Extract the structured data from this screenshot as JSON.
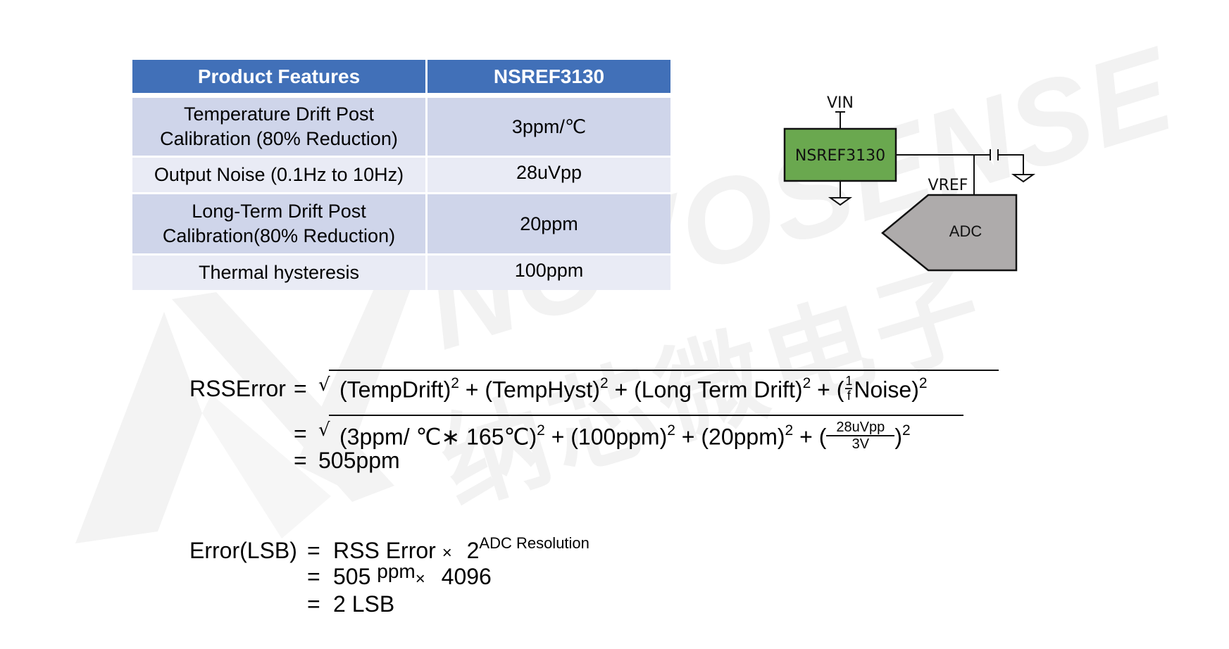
{
  "watermark": {
    "brand_en": "NOVOSENSE",
    "brand_cn": "纳芯微电子"
  },
  "table": {
    "headers": [
      "Product Features",
      "NSREF3130"
    ],
    "rows": [
      {
        "feature_line1": "Temperature Drift Post",
        "feature_line2": "Calibration (80% Reduction)",
        "value": "3ppm/℃"
      },
      {
        "feature_line1": "Output Noise (0.1Hz to 10Hz)",
        "feature_line2": "",
        "value": "28uVpp"
      },
      {
        "feature_line1": "Long-Term Drift Post",
        "feature_line2": "Calibration(80% Reduction)",
        "value": "20ppm"
      },
      {
        "feature_line1": "Thermal hysteresis",
        "feature_line2": "",
        "value": "100ppm"
      }
    ]
  },
  "circuit": {
    "vin_label": "VIN",
    "chip_label": "NSREF3130",
    "vref_label": "VREF",
    "adc_label": "ADC",
    "colors": {
      "chip": "#6aa84f",
      "adc": "#aeabab"
    }
  },
  "rss_formula": {
    "lhs": "RSSError",
    "eq": "=",
    "line1_terms": [
      {
        "text": "(TempDrift)",
        "sup": "2"
      },
      {
        "text": " + (TempHyst)",
        "sup": "2"
      },
      {
        "text": " + (Long Term Drift)",
        "sup": "2"
      },
      {
        "text": " + (",
        "frac_num": "1",
        "frac_den": "f",
        "after": "Noise)",
        "sup": "2"
      }
    ],
    "line2_terms": [
      {
        "text": "(3ppm/ ℃∗ 165℃)",
        "sup": "2"
      },
      {
        "text": " + (100ppm)",
        "sup": "2"
      },
      {
        "text": " + (20ppm)",
        "sup": "2"
      },
      {
        "text": " + (",
        "frac_num": "28uVpp",
        "frac_den": "3V",
        "after": ")",
        "sup": "2"
      }
    ],
    "result": "505ppm"
  },
  "lsb_formula": {
    "lhs": "Error(LSB)",
    "eq": "=",
    "line1": {
      "a": "RSS Error",
      "op": "×",
      "base": "2",
      "exp": "ADC Resolution"
    },
    "line2": {
      "a": "505",
      "unit": "ppm",
      "op": "×",
      "b": "4096"
    },
    "line3": {
      "result": "2 LSB"
    }
  }
}
